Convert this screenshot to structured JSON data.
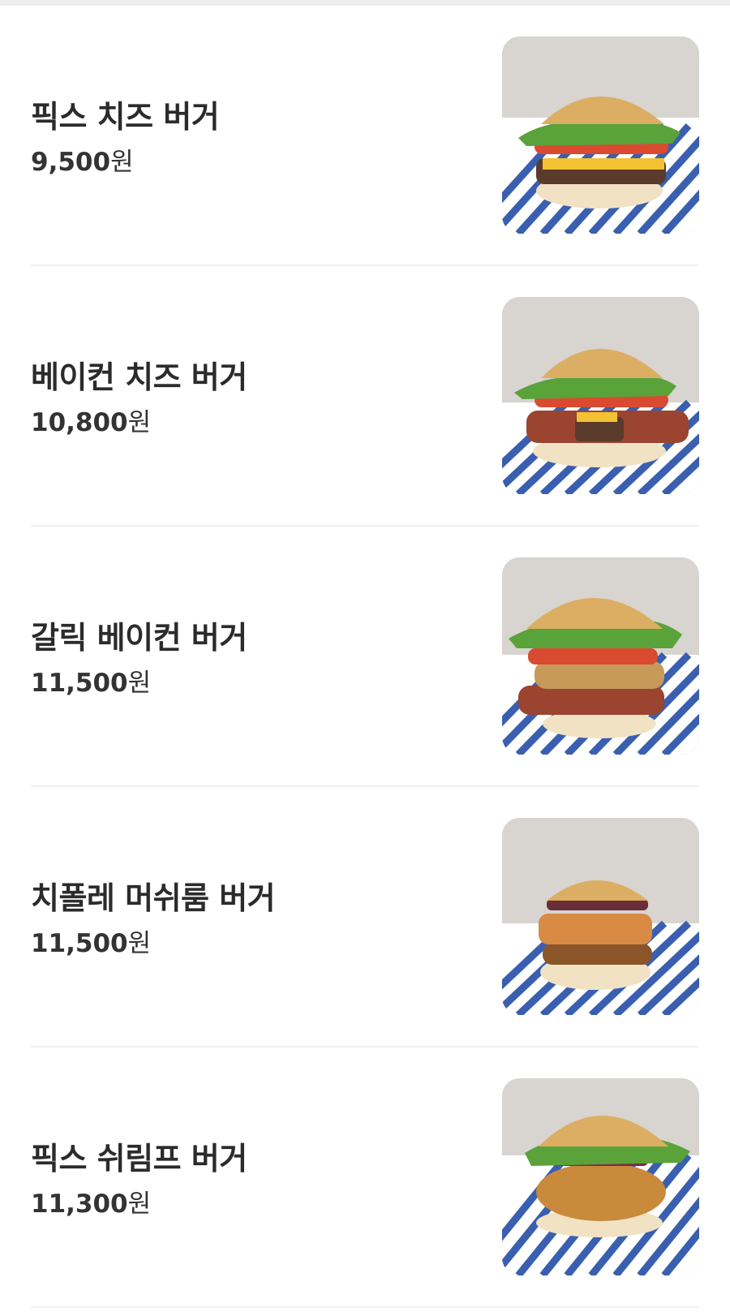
{
  "menu": {
    "items": [
      {
        "name": "픽스 치즈 버거",
        "price_num": "9,500",
        "price_unit": "원",
        "image": "burger-photo"
      },
      {
        "name": "베이컨 치즈 버거",
        "price_num": "10,800",
        "price_unit": "원",
        "image": "burger-photo"
      },
      {
        "name": "갈릭 베이컨 버거",
        "price_num": "11,500",
        "price_unit": "원",
        "image": "burger-photo"
      },
      {
        "name": "치폴레 머쉬룸 버거",
        "price_num": "11,500",
        "price_unit": "원",
        "image": "burger-photo"
      },
      {
        "name": "픽스 쉬림프 버거",
        "price_num": "11,300",
        "price_unit": "원",
        "image": "burger-photo"
      }
    ]
  },
  "colors": {
    "text": "#2b2b2b",
    "divider": "#f0f0f0",
    "stripe": "#3a5fb0",
    "bun": "#d9a85a"
  }
}
